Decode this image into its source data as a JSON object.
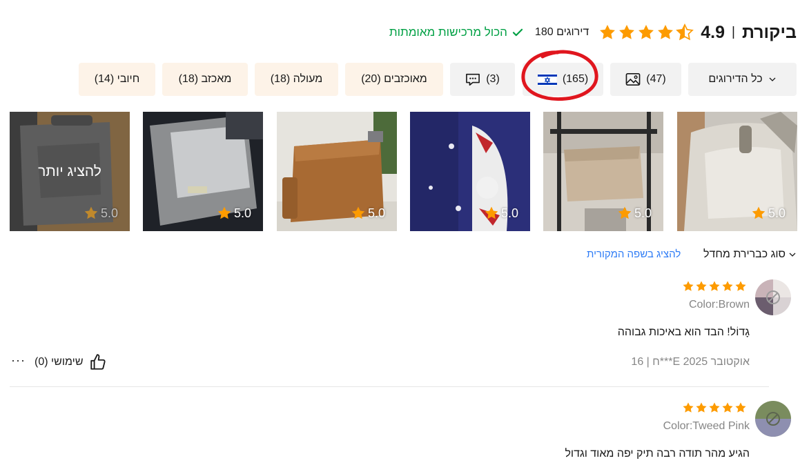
{
  "header": {
    "title": "ביקורת",
    "separator": "|",
    "rating": "4.9",
    "count": "180 דירוגים",
    "verified": "הכול מרכישות מאומתות"
  },
  "filters": [
    {
      "label": "כל הדירוגים",
      "icon": "chevron-down-icon"
    },
    {
      "label": "(47)",
      "icon": "image-icon"
    },
    {
      "label": "(165)",
      "icon": "israel-flag-icon"
    },
    {
      "label": "(3)",
      "icon": "comment-icon"
    },
    {
      "label": "מאוכזבים (20)"
    },
    {
      "label": "מעולה (18)"
    },
    {
      "label": "מאכזב (18)"
    },
    {
      "label": "חיובי (14)"
    }
  ],
  "thumbnails": [
    {
      "rating": "5.0"
    },
    {
      "rating": "5.0"
    },
    {
      "rating": "5.0"
    },
    {
      "rating": "5.0"
    },
    {
      "rating": "5.0"
    },
    {
      "rating": "5.0",
      "overlay": "להציג יותר"
    }
  ],
  "sort": {
    "label": "סוג כברירת מחדל",
    "show_original": "להציג בשפה המקורית"
  },
  "reviews": [
    {
      "sku": "Color:Brown",
      "text": "גָדוֹל! הבד הוא באיכות גבוהה",
      "meta": "16 | ח***E אוקטובר 2025",
      "helpful": "שימושי (0)",
      "more": "···"
    },
    {
      "sku": "Color:Tweed Pink",
      "text": "הגיע מהר תודה רבה תיק יפה מאוד וגדול"
    }
  ],
  "colors": {
    "star": "#fd9b00",
    "verified": "#00a044",
    "link": "#2e7cf6",
    "annotation": "#e0161e"
  }
}
